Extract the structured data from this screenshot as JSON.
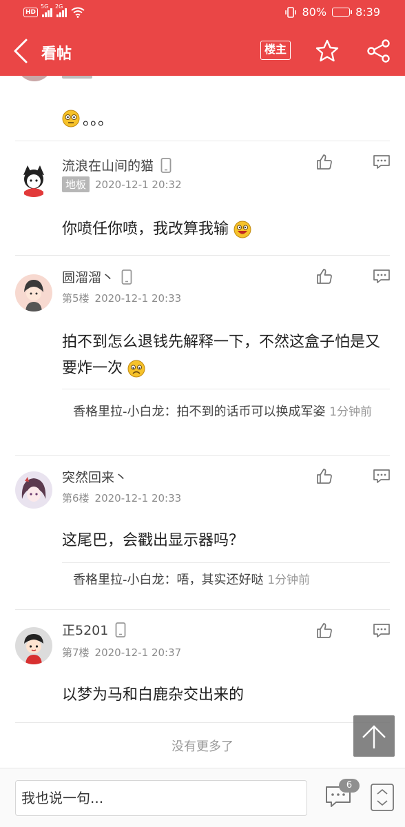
{
  "status_bar": {
    "hd": "HD",
    "net1": "5G",
    "net2": "2G",
    "battery": "80%",
    "battery_level": 0.8,
    "time": "8:39"
  },
  "nav": {
    "title": "看帖",
    "louzhu_label": "楼主"
  },
  "posts": [
    {
      "username": "流浪在山间的猫",
      "floor": "地板",
      "time": "2020-12-1 20:32",
      "text": "你喷任你喷，我改算我输"
    },
    {
      "username": "圆溜溜丶",
      "floor": "第5楼",
      "time": "2020-12-1 20:33",
      "text": "拍不到怎么退钱先解释一下，不然这盒子怕是又要炸一次",
      "reply_user": "香格里拉-小白龙：",
      "reply_text": "拍不到的话币可以换成军姿",
      "reply_time": "1分钟前"
    },
    {
      "username": "突然回来丶",
      "floor": "第6楼",
      "time": "2020-12-1 20:33",
      "text": "这尾巴，会戳出显示器吗？",
      "reply_user": "香格里拉-小白龙：",
      "reply_text": "唔，其实还好哒",
      "reply_time": "1分钟前"
    },
    {
      "username": "正5201",
      "floor": "第7楼",
      "time": "2020-12-1 20:37",
      "text": "以梦为马和白鹿杂交出来的"
    }
  ],
  "partial_post": {
    "text": "。。。"
  },
  "footer": {
    "no_more": "没有更多了",
    "input_placeholder": "我也说一句...",
    "reply_count": "6"
  },
  "colors": {
    "brand": "#ea4646",
    "meta": "#8c8c8c"
  }
}
